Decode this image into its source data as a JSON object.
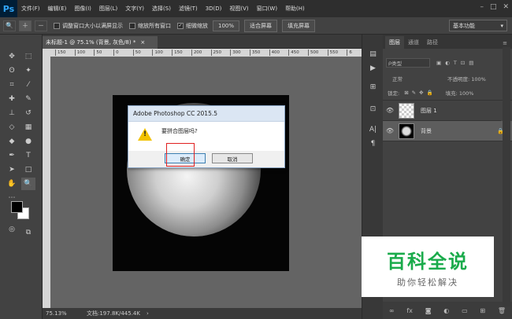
{
  "app": {
    "logo": "Ps"
  },
  "menu": [
    "文件(F)",
    "编辑(E)",
    "图像(I)",
    "图层(L)",
    "文字(Y)",
    "选择(S)",
    "滤镜(T)",
    "3D(D)",
    "视图(V)",
    "窗口(W)",
    "帮助(H)"
  ],
  "window_controls": {
    "minimize": "–",
    "maximize": "□",
    "close": "✕"
  },
  "options": {
    "resize_windows": "调整窗口大小以满屏显示",
    "zoom_all": "缩放所有窗口",
    "scrubby_zoom": "细微缩放",
    "zoom_pct": "100%",
    "fit_screen": "适合屏幕",
    "fill_screen": "填充屏幕",
    "workspace": "基本功能"
  },
  "document": {
    "tab_title": "未标题-1 @ 75.1% (背景, 灰色/8) *",
    "close": "×"
  },
  "ruler": {
    "h_ticks": [
      "150",
      "100",
      "50",
      "0",
      "50",
      "100",
      "150",
      "200",
      "250",
      "300",
      "350",
      "400",
      "450",
      "500",
      "550",
      "6"
    ]
  },
  "status": {
    "zoom": "75.13%",
    "doc_info": "文档:197.8K/445.4K"
  },
  "dialog": {
    "title": "Adobe Photoshop CC 2015.5",
    "message": "要拼合图层吗?",
    "ok": "确定",
    "cancel": "取消"
  },
  "panel": {
    "tabs": [
      "图层",
      "通道",
      "路径"
    ],
    "filter_kind": "类型",
    "blend_mode": "正常",
    "opacity_label": "不透明度: 100%",
    "lock_label": "锁定:",
    "fill_label": "填充: 100%",
    "layers": [
      {
        "name": "图层 1"
      },
      {
        "name": "背景"
      }
    ]
  },
  "watermark": {
    "big": "百科全说",
    "small": "助你轻松解决"
  },
  "colors": {
    "accent": "#31a8ff",
    "watermark_green": "#1aab4b",
    "highlight": "#e02020"
  }
}
